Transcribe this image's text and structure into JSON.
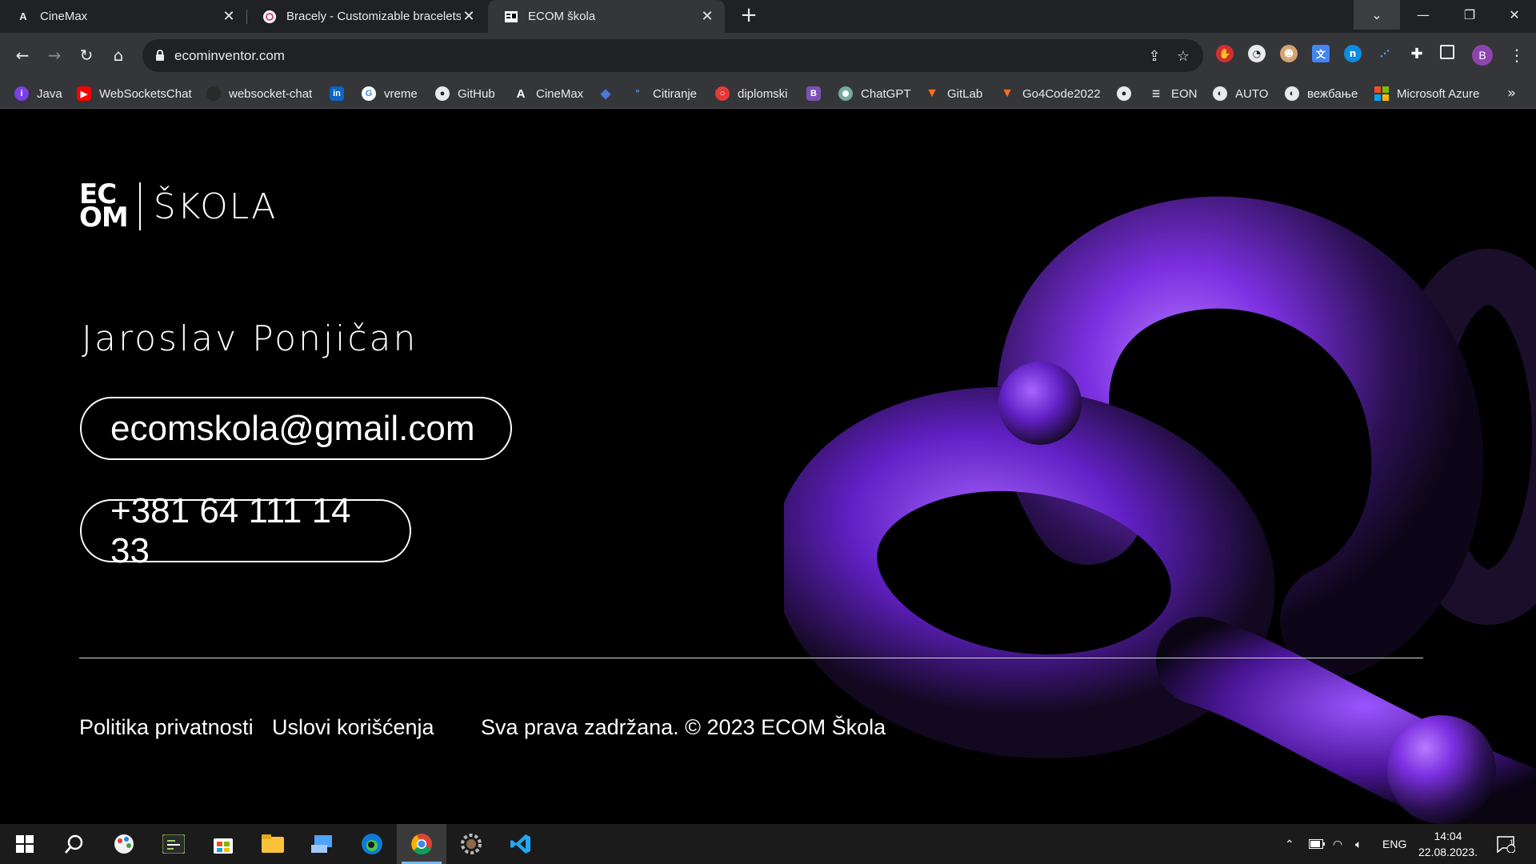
{
  "browser": {
    "tabs": [
      {
        "title": "CineMax",
        "icon": "cinemax-icon"
      },
      {
        "title": "Bracely - Customizable bracelets",
        "icon": "bracely-icon"
      },
      {
        "title": "ECOM škola",
        "icon": "ecom-icon"
      }
    ],
    "new_tab": "+",
    "url": "ecominventor.com",
    "bookmarks": [
      {
        "label": "Java",
        "color": "#7b3fe4"
      },
      {
        "label": "WebSocketsChat",
        "color": "#ff0000"
      },
      {
        "label": "websocket-chat",
        "color": "#24292e"
      },
      {
        "label": "",
        "color": "#0a66c2"
      },
      {
        "label": "vreme",
        "color": "#ffffff"
      },
      {
        "label": "GitHub",
        "color": "#24292e"
      },
      {
        "label": "CineMax",
        "color": "#35363a"
      },
      {
        "label": "",
        "color": "#4a7bd8"
      },
      {
        "label": "Citiranje",
        "color": "#35363a"
      },
      {
        "label": "diplomski",
        "color": "#e53935"
      },
      {
        "label": "",
        "color": "#7952b3"
      },
      {
        "label": "ChatGPT",
        "color": "#74aa9c"
      },
      {
        "label": "GitLab",
        "color": "#fc6d26"
      },
      {
        "label": "Go4Code2022",
        "color": "#fc6d26"
      },
      {
        "label": "",
        "color": "#24292e"
      },
      {
        "label": "EON",
        "color": "#35363a"
      },
      {
        "label": "AUTO",
        "color": "#35363a"
      },
      {
        "label": "вежбање",
        "color": "#35363a"
      },
      {
        "label": "Microsoft Azure",
        "color": "#f25022"
      }
    ],
    "bookmarks_more": "»",
    "avatar_letter": "B"
  },
  "page": {
    "logo_mark_top": "EC",
    "logo_mark_bottom": "OM",
    "logo_word": "ŠKOLA",
    "name": "Jaroslav Ponjičan",
    "email": "ecomskola@gmail.com",
    "phone": "+381 64 111 14 33",
    "footer": {
      "privacy": "Politika privatnosti",
      "terms": "Uslovi korišćenja",
      "copyright": "Sva prava zadržana. © 2023 ECOM Škola"
    },
    "accent": "#8a3cf2"
  },
  "taskbar": {
    "language": "ENG",
    "time": "14:04",
    "date": "22.08.2023.",
    "notifications": "1"
  }
}
